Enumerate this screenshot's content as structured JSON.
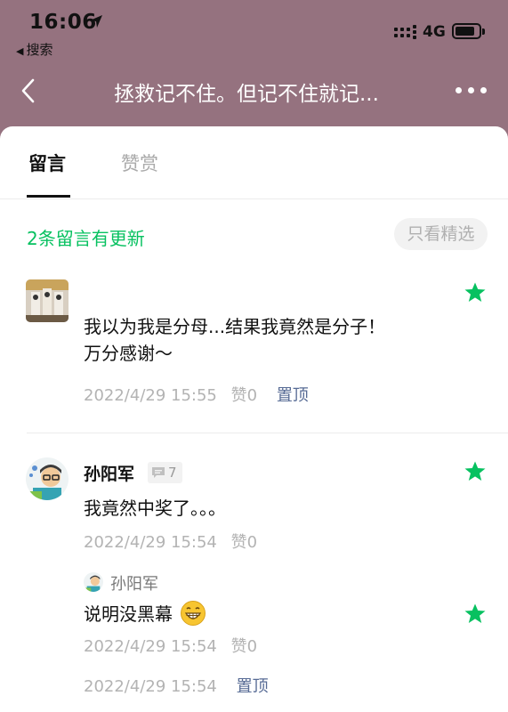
{
  "status_bar": {
    "time": "16:06",
    "back_app": "搜索",
    "network": "4G"
  },
  "nav": {
    "title": "拯救记不住。但记不住就记..."
  },
  "tabs": [
    {
      "label": "留言",
      "active": true
    },
    {
      "label": "赞赏",
      "active": false
    }
  ],
  "updates_text": "2条留言有更新",
  "filter_label": "只看精选",
  "accent_color": "#07c160",
  "comments": [
    {
      "author": "",
      "content_line1": "我以为我是分母...结果我竟然是分子！",
      "content_line2": "万分感谢～",
      "time": "2022/4/29 15:55",
      "likes": "赞0",
      "pin": "置顶",
      "starred": true
    },
    {
      "author": "孙阳军",
      "reply_count": "7",
      "content": "我竟然中奖了。。。",
      "time": "2022/4/29 15:54",
      "likes": "赞0",
      "starred": true,
      "reply": {
        "author": "孙阳军",
        "content": "说明没黑幕",
        "time": "2022/4/29 15:54",
        "likes": "赞0",
        "starred": true
      },
      "footer_time": "2022/4/29 15:54",
      "footer_pin": "置顶"
    }
  ]
}
